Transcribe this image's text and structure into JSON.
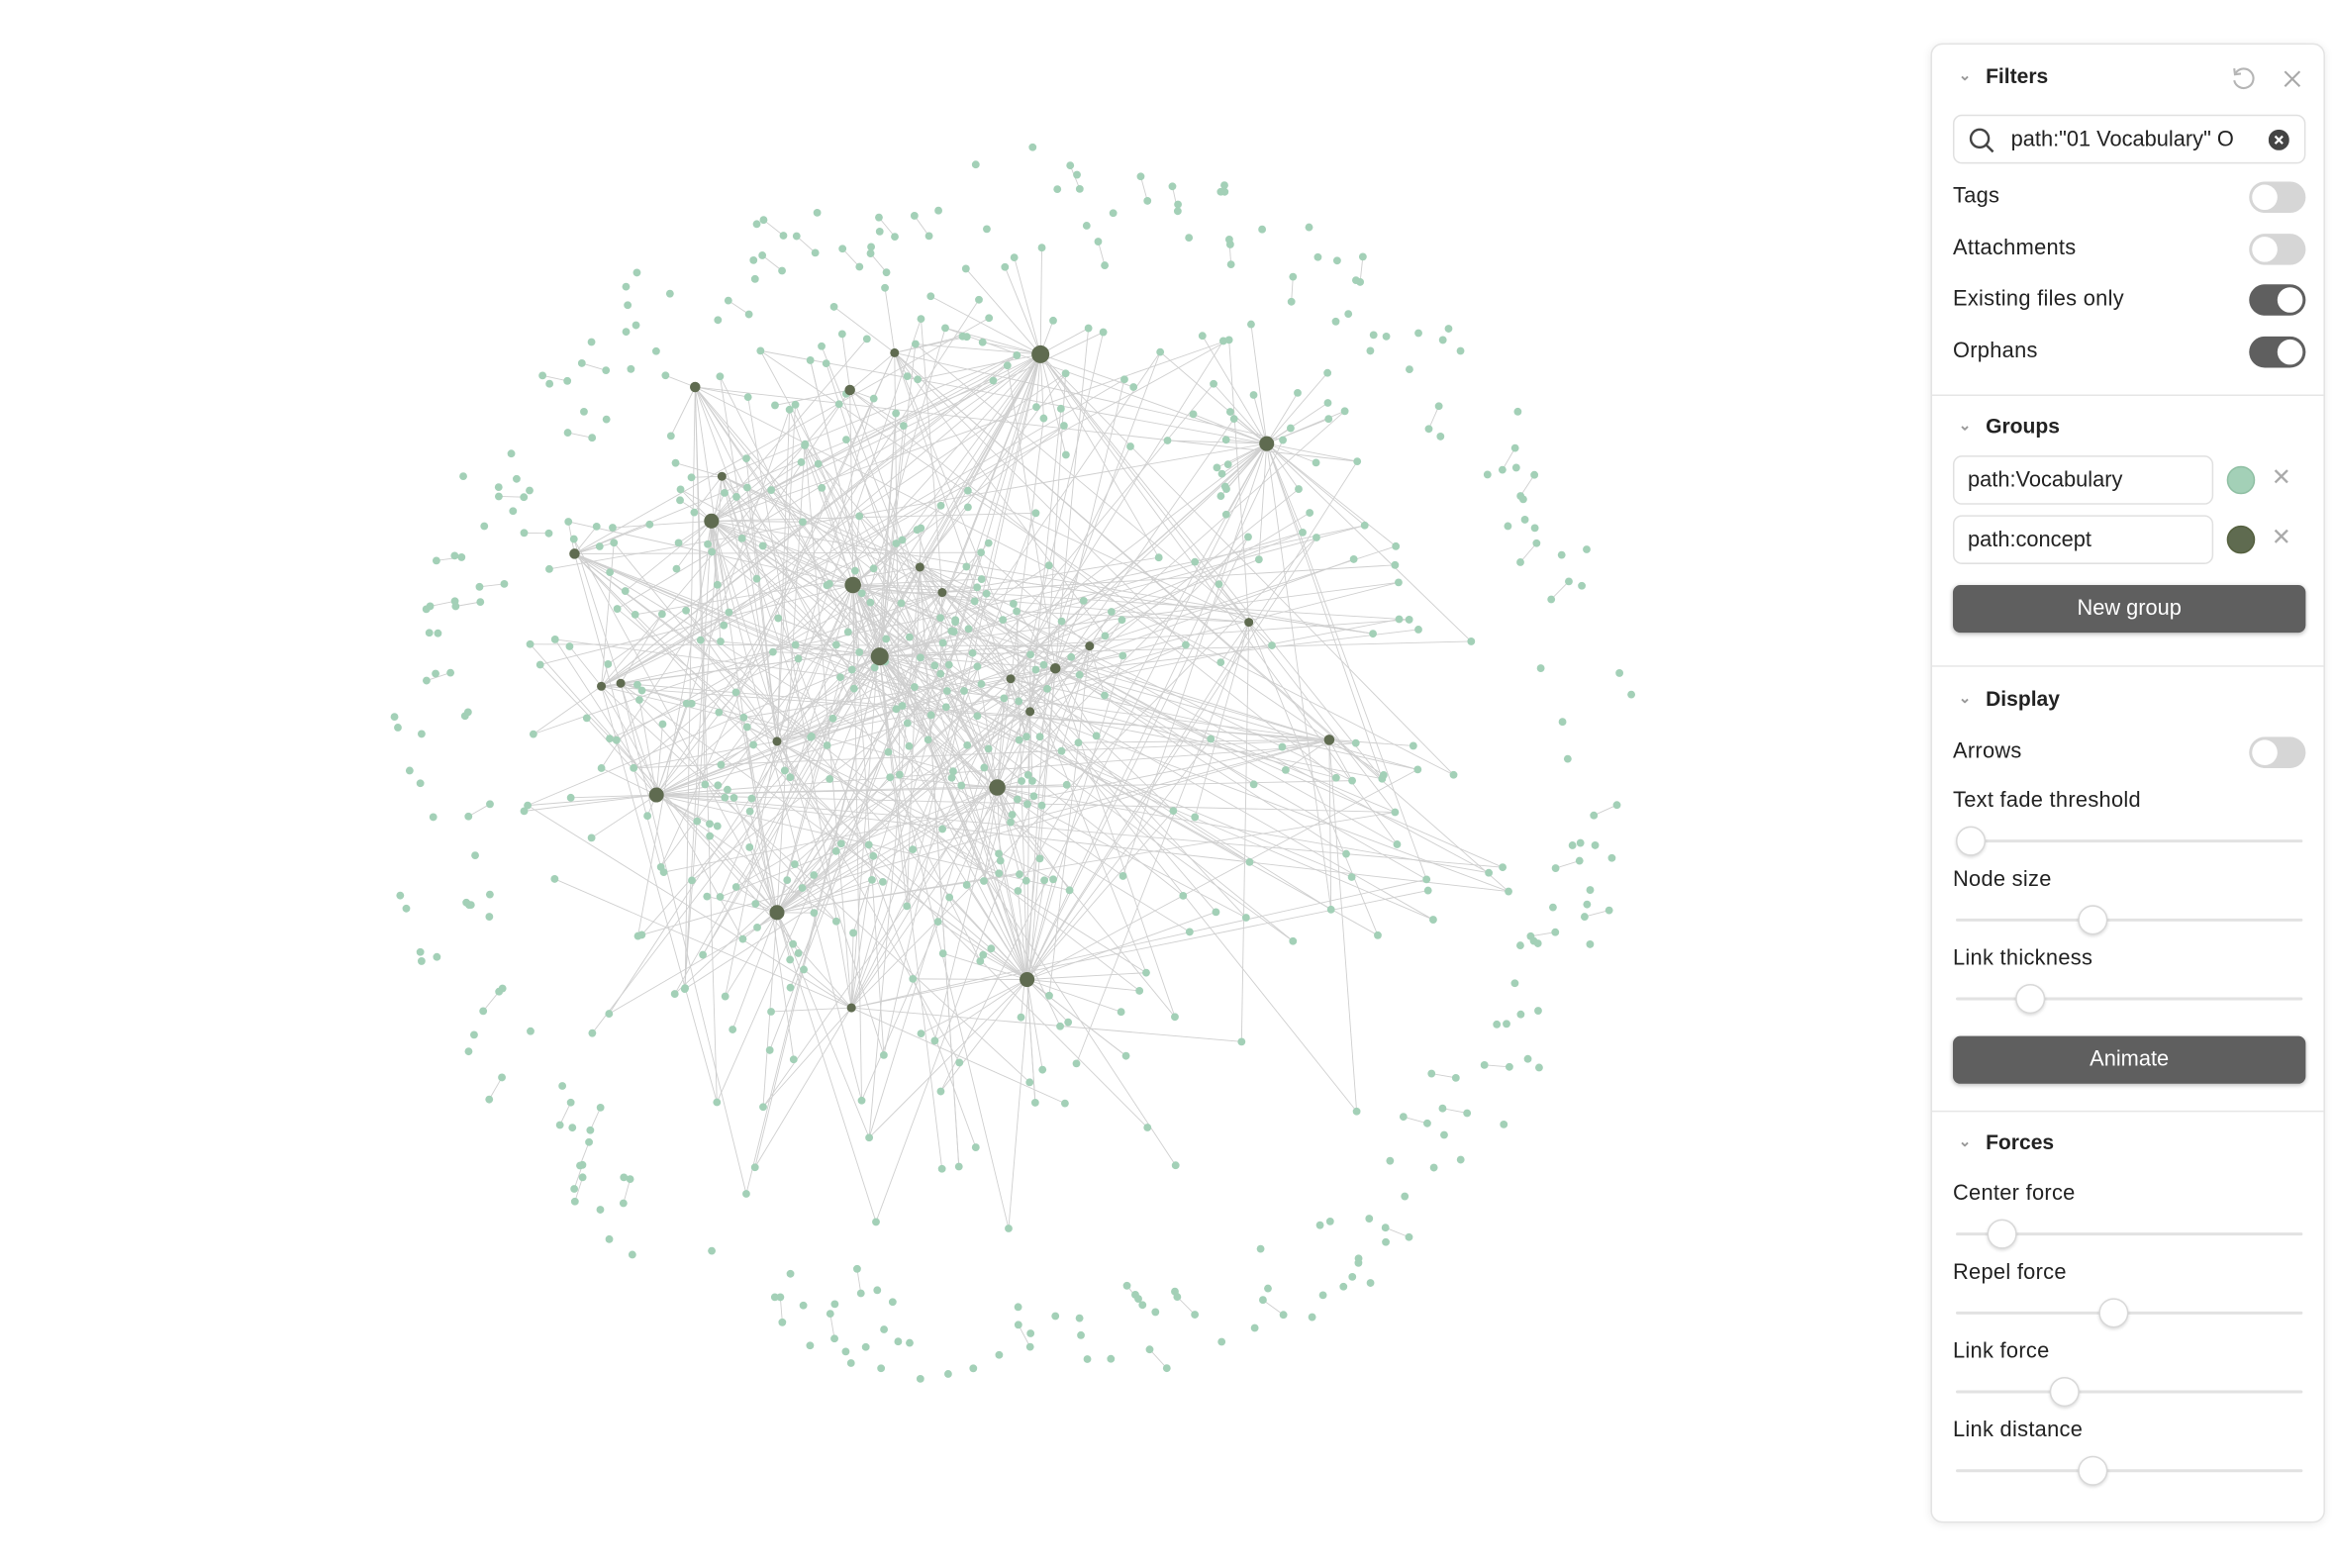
{
  "colors": {
    "node": "#a3d0b7",
    "hub": "#5f6b50",
    "link": "#cfcfcf"
  },
  "filters": {
    "title": "Filters",
    "search_value": "path:\"01 Vocabulary\" O",
    "toggles": [
      {
        "label": "Tags",
        "on": false
      },
      {
        "label": "Attachments",
        "on": false
      },
      {
        "label": "Existing files only",
        "on": true
      },
      {
        "label": "Orphans",
        "on": true
      }
    ]
  },
  "groups": {
    "title": "Groups",
    "items": [
      {
        "query": "path:Vocabulary",
        "color": "#a3d0b7"
      },
      {
        "query": "path:concept",
        "color": "#5f6b50"
      }
    ],
    "new_group_label": "New group"
  },
  "display": {
    "title": "Display",
    "arrows_label": "Arrows",
    "arrows_on": false,
    "sliders": [
      {
        "label": "Text fade threshold",
        "value": 0.04
      },
      {
        "label": "Node size",
        "value": 0.39
      },
      {
        "label": "Link thickness",
        "value": 0.21
      }
    ],
    "animate_label": "Animate"
  },
  "forces": {
    "title": "Forces",
    "sliders": [
      {
        "label": "Center force",
        "value": 0.13
      },
      {
        "label": "Repel force",
        "value": 0.45
      },
      {
        "label": "Link force",
        "value": 0.31
      },
      {
        "label": "Link distance",
        "value": 0.39
      }
    ]
  }
}
